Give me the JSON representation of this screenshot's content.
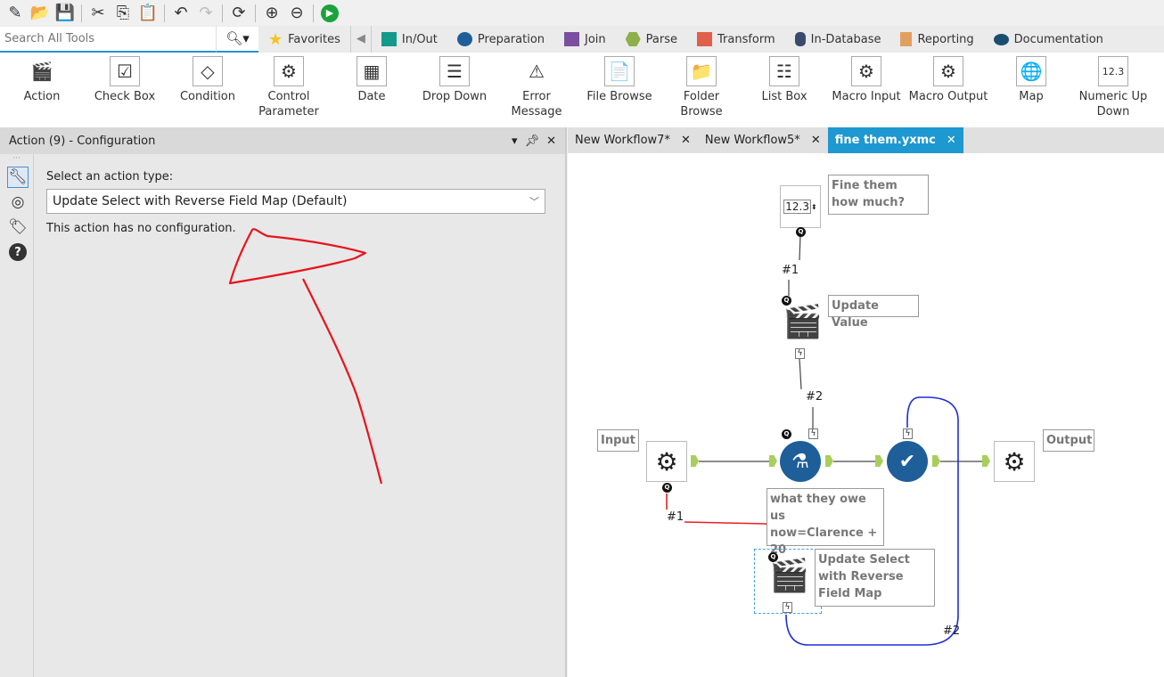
{
  "toolbar": {
    "icons": [
      "new-workflow-icon",
      "open-icon",
      "save-icon",
      "cut-icon",
      "copy-icon",
      "paste-icon",
      "undo-icon",
      "redo-icon",
      "refresh-icon",
      "zoom-in-icon",
      "zoom-out-icon",
      "run-icon"
    ]
  },
  "search": {
    "placeholder": "Search All Tools"
  },
  "categories": [
    {
      "label": "Favorites",
      "color": "#f5c518"
    },
    {
      "label": "In/Out",
      "color": "#139a8a"
    },
    {
      "label": "Preparation",
      "color": "#1e5e99"
    },
    {
      "label": "Join",
      "color": "#7a4fa0"
    },
    {
      "label": "Parse",
      "color": "#8db04a"
    },
    {
      "label": "Transform",
      "color": "#e0604a"
    },
    {
      "label": "In-Database",
      "color": "#3a4a6a"
    },
    {
      "label": "Reporting",
      "color": "#e2a060"
    },
    {
      "label": "Documentation",
      "color": "#1a4e70"
    }
  ],
  "palette": [
    {
      "label": "Action",
      "icon": "🎬"
    },
    {
      "label": "Check Box",
      "icon": "☑"
    },
    {
      "label": "Condition",
      "icon": "◇"
    },
    {
      "label": "Control Parameter",
      "icon": "⚙"
    },
    {
      "label": "Date",
      "icon": "▦"
    },
    {
      "label": "Drop Down",
      "icon": "☰"
    },
    {
      "label": "Error Message",
      "icon": "⚠"
    },
    {
      "label": "File Browse",
      "icon": "📄"
    },
    {
      "label": "Folder Browse",
      "icon": "📁"
    },
    {
      "label": "List Box",
      "icon": "☷"
    },
    {
      "label": "Macro Input",
      "icon": "⚙"
    },
    {
      "label": "Macro Output",
      "icon": "⚙"
    },
    {
      "label": "Map",
      "icon": "🌐"
    },
    {
      "label": "Numeric Up Down",
      "icon": "12.3"
    }
  ],
  "panel": {
    "title": "Action (9) - Configuration",
    "prompt": "Select an action type:",
    "selected_action": "Update Select with Reverse Field Map (Default)",
    "note": "This action has no configuration."
  },
  "tabs": [
    {
      "label": "New Workflow7*",
      "active": false
    },
    {
      "label": "New Workflow5*",
      "active": false
    },
    {
      "label": "fine them.yxmc",
      "active": true
    }
  ],
  "canvas": {
    "numeric_value": "12.3",
    "annotations": {
      "fine": "Fine them how much?",
      "update_value": "Update Value",
      "input": "Input",
      "output": "Output",
      "formula": "what they owe us now=Clarence + 20",
      "update_select": "Update Select with Reverse Field Map"
    },
    "labels": {
      "c1": "#1",
      "c2": "#2",
      "c3": "#1",
      "c4": "#2"
    }
  }
}
